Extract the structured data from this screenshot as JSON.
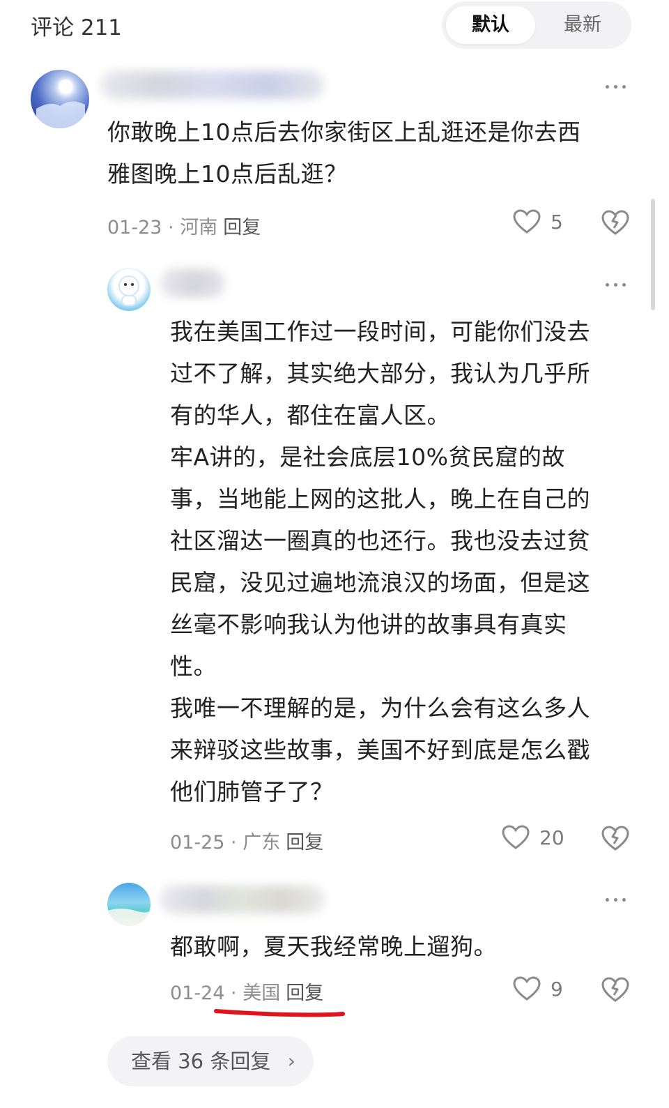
{
  "header": {
    "comment_count": "评论 211",
    "sort_default": "默认",
    "sort_latest": "最新"
  },
  "comments": [
    {
      "lines": [
        "你敢晚上10点后去你家街区上乱逛还是你去西",
        "雅图晚上10点后乱逛？"
      ],
      "date": "01-23",
      "location": "河南",
      "reply_label": "回复",
      "likes": "5"
    },
    {
      "lines": [
        "我在美国工作过一段时间，可能你们没去",
        "过不了解，其实绝大部分，我认为几乎所",
        "有的华人，都住在富人区。",
        "牢A讲的，是社会底层10%贫民窟的故",
        "事，当地能上网的这批人，晚上在自己的",
        "社区溜达一圈真的也还行。我也没去过贫",
        "民窟，没见过遍地流浪汉的场面，但是这",
        "丝毫不影响我认为他讲的故事具有真实",
        "性。",
        "我唯一不理解的是，为什么会有这么多人",
        "来辩驳这些故事，美国不好到底是怎么戳",
        "他们肺管子了？"
      ],
      "date": "01-25",
      "location": "广东",
      "reply_label": "回复",
      "likes": "20"
    },
    {
      "lines": [
        "都敢啊，夏天我经常晚上遛狗。"
      ],
      "date": "01-24",
      "location": "美国",
      "reply_label": "回复",
      "likes": "9"
    }
  ],
  "view_replies": {
    "label": "查看 36 条回复",
    "chevron": "›"
  },
  "colors": {
    "annotation_red": "#e0141c",
    "meta_gray": "#8c8c8c"
  },
  "icons": [
    "more-icon",
    "heart-icon",
    "broken-heart-icon",
    "chevron-right-icon"
  ]
}
